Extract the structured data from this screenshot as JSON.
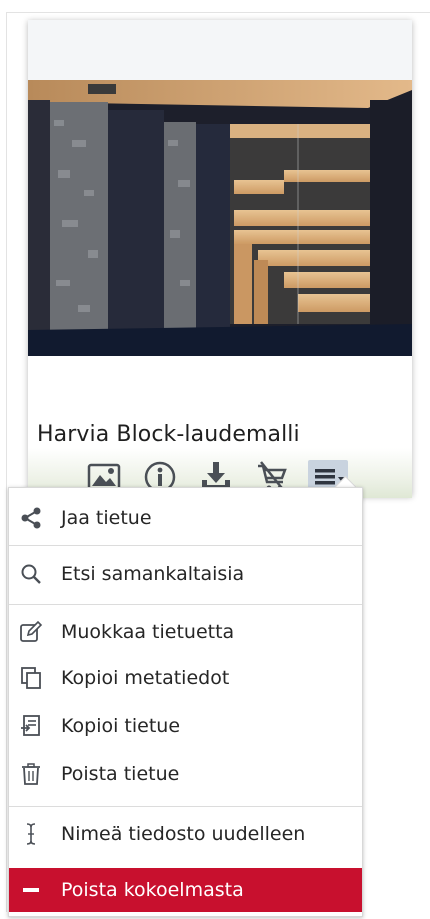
{
  "card": {
    "title": "Harvia Block-laudemalli",
    "image_alt": "Sauna with dark stone walls and wooden benches"
  },
  "toolbar": {
    "buttons": [
      {
        "name": "image-button",
        "icon": "image-icon"
      },
      {
        "name": "info-button",
        "icon": "info-icon"
      },
      {
        "name": "download-button",
        "icon": "download-icon"
      },
      {
        "name": "remove-from-cart-button",
        "icon": "cart-remove-icon"
      },
      {
        "name": "more-menu-button",
        "icon": "menu-dropdown-icon"
      }
    ]
  },
  "menu": {
    "items": [
      {
        "label": "Jaa tietue",
        "icon": "share-icon"
      },
      {
        "label": "Etsi samankaltaisia",
        "icon": "search-icon"
      },
      {
        "label": "Muokkaa tietuetta",
        "icon": "edit-icon"
      },
      {
        "label": "Kopioi metatiedot",
        "icon": "copy-icon"
      },
      {
        "label": "Kopioi tietue",
        "icon": "copy-record-icon"
      },
      {
        "label": "Poista tietue",
        "icon": "trash-icon"
      },
      {
        "label": "Nimeä tiedosto uudelleen",
        "icon": "rename-cursor-icon"
      },
      {
        "label": "Poista kokoelmasta",
        "icon": "minus-icon"
      }
    ]
  },
  "colors": {
    "danger": "#c8102e",
    "active_button": "#c9d3df"
  }
}
